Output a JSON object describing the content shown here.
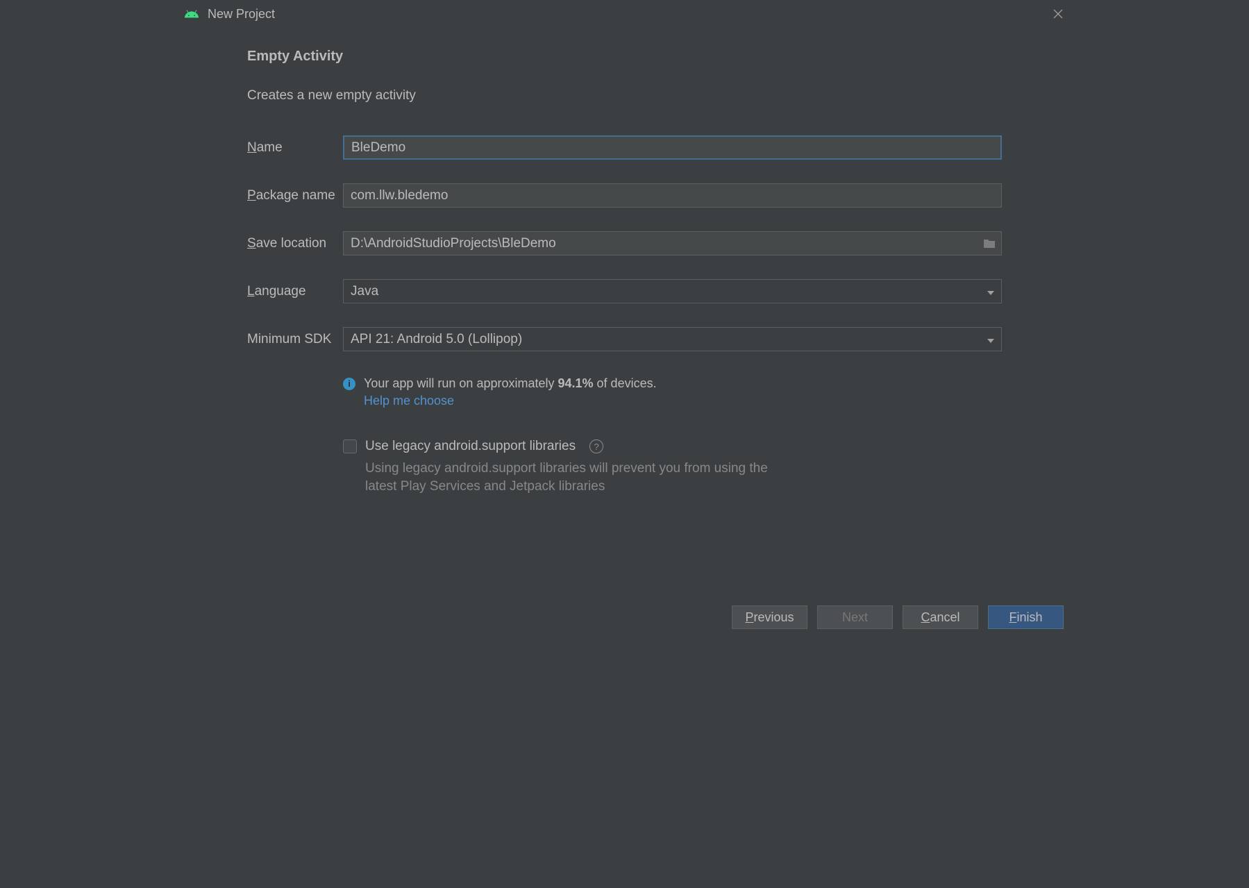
{
  "titlebar": {
    "title": "New Project"
  },
  "header": {
    "title": "Empty Activity",
    "description": "Creates a new empty activity"
  },
  "fields": {
    "name": {
      "label_prefix": "N",
      "label_rest": "ame",
      "value": "BleDemo"
    },
    "package": {
      "label_prefix": "P",
      "label_rest": "ackage name",
      "value": "com.llw.bledemo"
    },
    "save": {
      "label_prefix": "S",
      "label_rest": "ave location",
      "value": "D:\\AndroidStudioProjects\\BleDemo"
    },
    "language": {
      "label_prefix": "L",
      "label_rest": "anguage",
      "value": "Java"
    },
    "minsdk": {
      "label": "Minimum SDK",
      "value": "API 21: Android 5.0 (Lollipop)"
    }
  },
  "info": {
    "text_before": "Your app will run on approximately ",
    "percent": "94.1%",
    "text_after": " of devices.",
    "help_link": "Help me choose"
  },
  "legacy": {
    "label": "Use legacy android.support libraries",
    "hint": "Using legacy android.support libraries will prevent you from using the latest Play Services and Jetpack libraries"
  },
  "buttons": {
    "previous_prefix": "P",
    "previous_rest": "revious",
    "next": "Next",
    "cancel_prefix": "C",
    "cancel_rest": "ancel",
    "finish_prefix": "F",
    "finish_rest": "inish"
  }
}
